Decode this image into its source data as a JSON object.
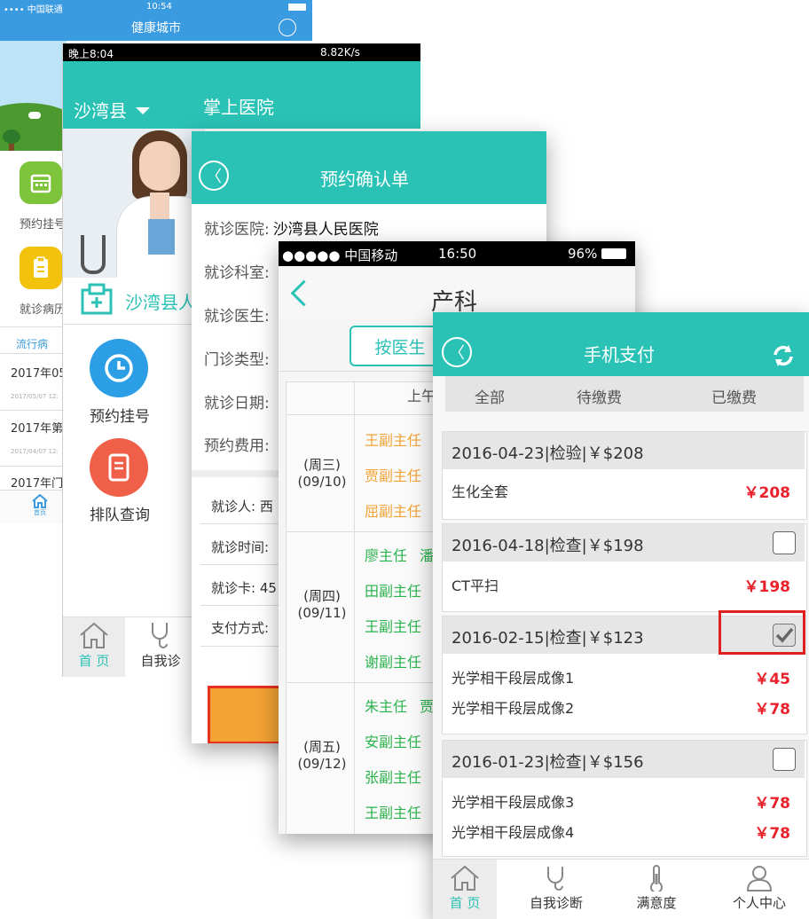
{
  "screen1": {
    "status_carrier": "•••• 中国联通 ",
    "status_time": "10:54",
    "title": "健康城市",
    "menu": [
      "预约挂号",
      "就诊病历"
    ],
    "tab": "流行病",
    "news": [
      {
        "title": "2017年05",
        "time": "2017/05/07 12:"
      },
      {
        "title": "2017年第2",
        "time": "2017/04/07 12:"
      },
      {
        "title": "2017年门"
      }
    ],
    "nav_home": "首页"
  },
  "screen2": {
    "status_time": "晚上8:04",
    "status_speed": "8.82K/s",
    "location": "沙湾县",
    "title": "掌上医院",
    "hospital": "沙湾县人",
    "menu": [
      "预约挂号",
      "排队查询"
    ],
    "nav": [
      "首 页",
      "自我诊"
    ]
  },
  "screen3": {
    "title": "预约确认单",
    "rows": [
      "就诊医院:",
      "就诊科室:",
      "就诊医生:",
      "门诊类型:",
      "就诊日期:",
      "预约费用:"
    ],
    "hospital_value": "沙湾县人民医院",
    "rows2": [
      "就诊人:",
      "就诊时间:",
      "就诊卡:",
      "支付方式:"
    ],
    "rows2_values": [
      "西",
      "",
      "45",
      ""
    ]
  },
  "screen4": {
    "status_carrier": "●●●●● 中国移动",
    "status_time": "16:50",
    "status_battery": "96%",
    "title": "产科",
    "button": "按医生",
    "col_header": "上午",
    "days": [
      {
        "wd": "(周三)",
        "date": "(09/10)",
        "docs": [
          [
            "王副主任",
            ""
          ],
          [
            "贾副主任",
            ""
          ],
          [
            "屈副主任",
            ""
          ]
        ]
      },
      {
        "wd": "(周四)",
        "date": "(09/11)",
        "docs": [
          [
            "廖主任",
            "潘"
          ],
          [
            "田副主任",
            ""
          ],
          [
            "王副主任",
            ""
          ],
          [
            "谢副主任",
            ""
          ]
        ]
      },
      {
        "wd": "(周五)",
        "date": "(09/12)",
        "docs": [
          [
            "朱主任",
            "贾"
          ],
          [
            "安副主任",
            ""
          ],
          [
            "张副主任",
            ""
          ],
          [
            "王副主任",
            ""
          ]
        ]
      }
    ]
  },
  "screen5": {
    "title": "手机支付",
    "tabs": [
      "全部",
      "待缴费",
      "已缴费"
    ],
    "groups": [
      {
        "header": "2016-04-23|检验|￥$208",
        "items": [
          {
            "name": "生化全套",
            "price": "￥208"
          }
        ],
        "checkbox": "none"
      },
      {
        "header": "2016-04-18|检查|￥$198",
        "items": [
          {
            "name": "CT平扫",
            "price": "￥198"
          }
        ],
        "checkbox": "empty"
      },
      {
        "header": "2016-02-15|检查|￥$123",
        "items": [
          {
            "name": "光学相干段层成像1",
            "price": "￥45"
          },
          {
            "name": "光学相干段层成像2",
            "price": "￥78"
          }
        ],
        "checkbox": "checked"
      },
      {
        "header": "2016-01-23|检查|￥$156",
        "items": [
          {
            "name": "光学相干段层成像3",
            "price": "￥78"
          },
          {
            "name": "光学相干段层成像4",
            "price": "￥78"
          }
        ],
        "checkbox": "empty"
      }
    ],
    "nav": [
      "首 页",
      "自我诊断",
      "满意度",
      "个人中心"
    ]
  },
  "colors": {
    "teal": "#2bc2b6",
    "blue": "#3a9be0",
    "green": "#2bb24c",
    "orange": "#f2a334",
    "red": "#e8212b",
    "highlight": "#e02020"
  }
}
